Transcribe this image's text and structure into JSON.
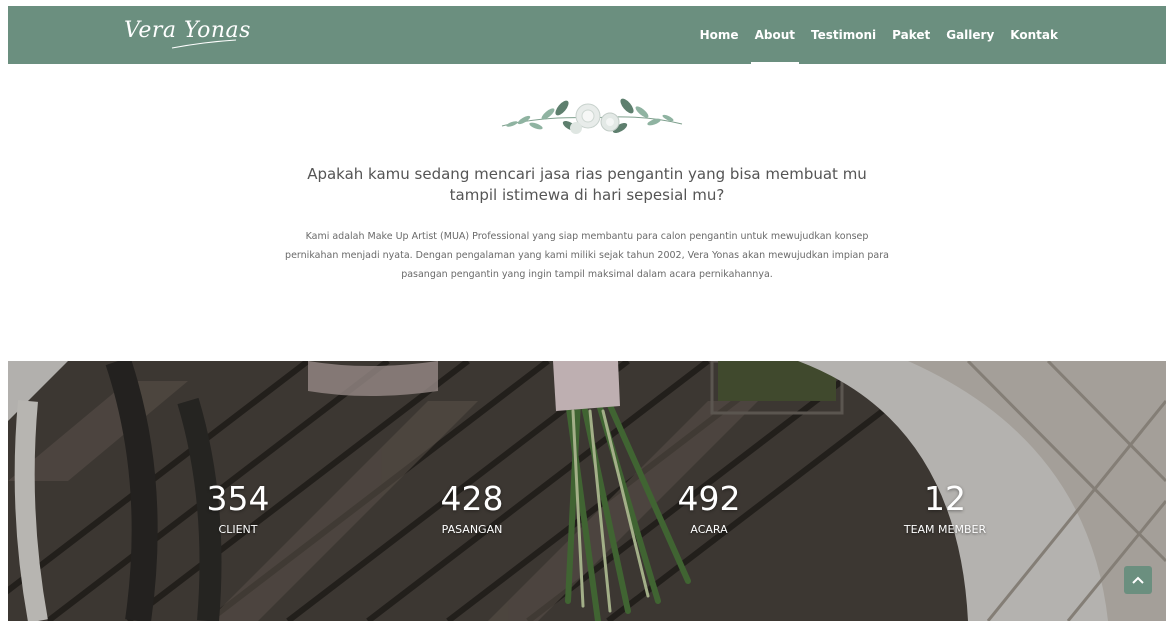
{
  "brand": {
    "logo_text": "Vera Yonas"
  },
  "nav": {
    "items": [
      "Home",
      "About",
      "Testimoni",
      "Paket",
      "Gallery",
      "Kontak"
    ],
    "active": "About"
  },
  "about": {
    "heading": "Apakah kamu sedang mencari jasa rias pengantin yang bisa membuat mu tampil istimewa di hari sepesial mu?",
    "paragraph": "Kami adalah Make Up Artist (MUA) Professional yang siap membantu para calon pengantin untuk mewujudkan konsep pernikahan menjadi nyata. Dengan pengalaman yang kami miliki sejak tahun 2002, Vera Yonas akan mewujudkan impian para pasangan pengantin yang ingin tampil maksimal dalam acara pernikahannya."
  },
  "counters": [
    {
      "value": "354",
      "label": "CLIENT"
    },
    {
      "value": "428",
      "label": "PASANGAN"
    },
    {
      "value": "492",
      "label": "ACARA"
    },
    {
      "value": "12",
      "label": "TEAM MEMBER"
    }
  ],
  "colors": {
    "nav_bg": "#6b8f7f",
    "text_dark": "#555555",
    "text_body": "#6a6a6a"
  },
  "icons": {
    "scroll_top": "chevron-up-icon"
  }
}
